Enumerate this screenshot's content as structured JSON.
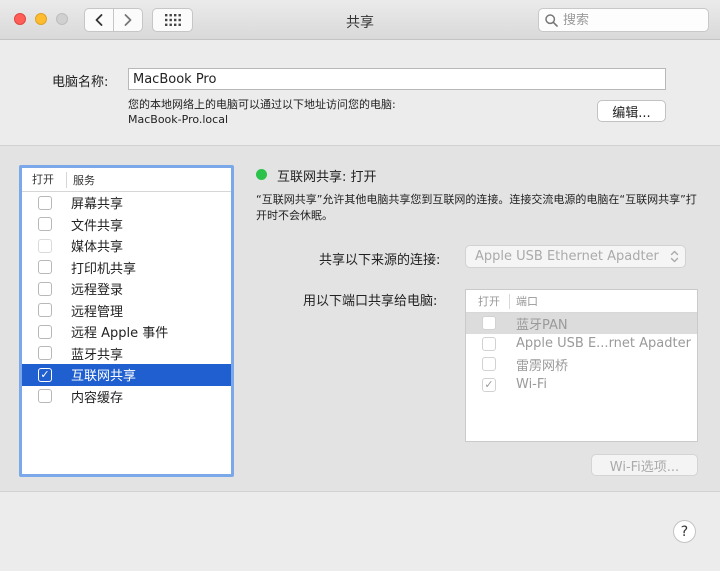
{
  "window": {
    "title": "共享",
    "search_placeholder": "搜索"
  },
  "computer": {
    "name_label": "电脑名称:",
    "name_value": "MacBook Pro",
    "desc_line1": "您的本地网络上的电脑可以通过以下地址访问您的电脑:",
    "desc_line2": "MacBook-Pro.local",
    "edit_button": "编辑..."
  },
  "services": {
    "header_open": "打开",
    "header_service": "服务",
    "items": [
      {
        "label": "屏幕共享",
        "checked": false
      },
      {
        "label": "文件共享",
        "checked": false
      },
      {
        "label": "媒体共享",
        "checked": false
      },
      {
        "label": "打印机共享",
        "checked": false
      },
      {
        "label": "远程登录",
        "checked": false
      },
      {
        "label": "远程管理",
        "checked": false
      },
      {
        "label": "远程 Apple 事件",
        "checked": false
      },
      {
        "label": "蓝牙共享",
        "checked": false
      },
      {
        "label": "互联网共享",
        "checked": true,
        "selected": true
      },
      {
        "label": "内容缓存",
        "checked": false
      }
    ]
  },
  "detail": {
    "status_color": "#2bc24a",
    "status_text": "互联网共享: 打开",
    "info_text": "“互联网共享”允许其他电脑共享您到互联网的连接。连接交流电源的电脑在“互联网共享”打开时不会休眠。",
    "source_label": "共享以下来源的连接:",
    "source_value": "Apple USB Ethernet Apadter",
    "ports_label": "用以下端口共享给电脑:",
    "ports_header_open": "打开",
    "ports_header_port": "端口",
    "ports": [
      {
        "label": "蓝牙PAN",
        "checked": false,
        "highlighted": true
      },
      {
        "label": "Apple USB E...rnet Apadter",
        "checked": false
      },
      {
        "label": "雷雳网桥",
        "checked": false
      },
      {
        "label": "Wi-Fi",
        "checked": true
      }
    ],
    "wifi_options_button": "Wi-Fi选项..."
  },
  "help": {
    "label": "?"
  }
}
